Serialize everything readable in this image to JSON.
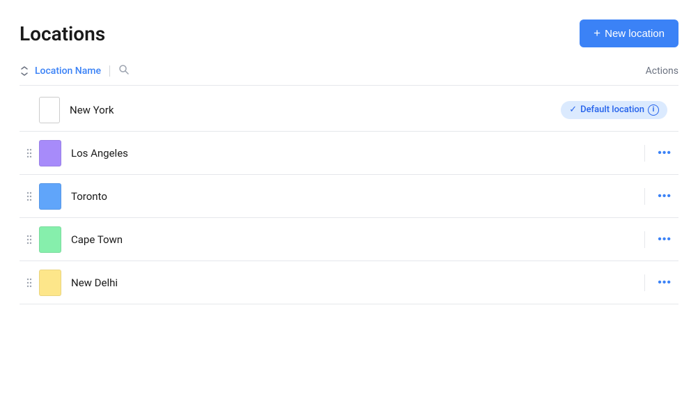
{
  "header": {
    "title": "Locations",
    "new_button_label": "New location",
    "new_button_icon": "+"
  },
  "toolbar": {
    "sort_icon": "↕",
    "column_label": "Location Name",
    "search_icon": "🔍",
    "actions_label": "Actions"
  },
  "locations": [
    {
      "id": "new-york",
      "name": "New York",
      "icon_type": "outline",
      "is_default": true,
      "default_label": "Default location",
      "has_drag": false
    },
    {
      "id": "los-angeles",
      "name": "Los Angeles",
      "icon_type": "color",
      "icon_color": "purple",
      "is_default": false,
      "has_drag": true
    },
    {
      "id": "toronto",
      "name": "Toronto",
      "icon_type": "color",
      "icon_color": "blue",
      "is_default": false,
      "has_drag": true
    },
    {
      "id": "cape-town",
      "name": "Cape Town",
      "icon_type": "color",
      "icon_color": "green",
      "is_default": false,
      "has_drag": true
    },
    {
      "id": "new-delhi",
      "name": "New Delhi",
      "icon_type": "color",
      "icon_color": "yellow",
      "is_default": false,
      "has_drag": true
    }
  ]
}
